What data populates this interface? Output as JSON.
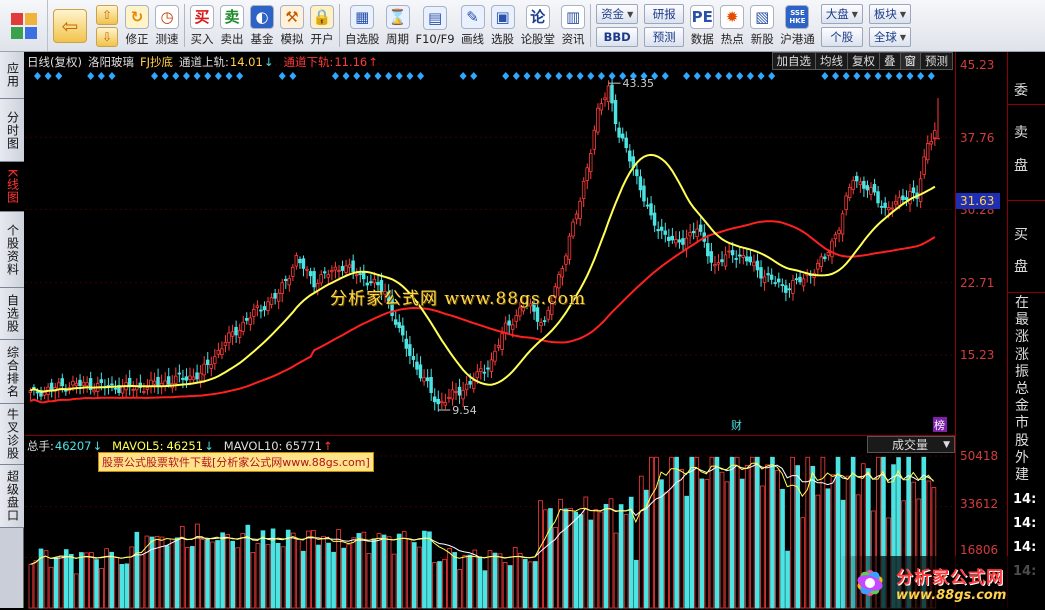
{
  "toolbar": {
    "groups": [
      {
        "label": "修正",
        "icon": "refresh-icon"
      },
      {
        "label": "测速",
        "icon": "clock-icon"
      },
      {
        "label": "买入",
        "icon": "buy-icon",
        "glyph": "买"
      },
      {
        "label": "卖出",
        "icon": "sell-icon",
        "glyph": "卖"
      },
      {
        "label": "基金",
        "icon": "fund-icon"
      },
      {
        "label": "模拟",
        "icon": "hammer-icon"
      },
      {
        "label": "开户",
        "icon": "lock-icon"
      },
      {
        "label": "自选股",
        "icon": "watchlist-icon"
      },
      {
        "label": "周期",
        "icon": "period-icon"
      },
      {
        "label": "F10/F9",
        "icon": "f10-icon"
      },
      {
        "label": "画线",
        "icon": "draw-line-icon"
      },
      {
        "label": "选股",
        "icon": "stock-picker-icon"
      },
      {
        "label": "论股堂",
        "icon": "discussion-icon",
        "glyph": "论"
      },
      {
        "label": "资讯",
        "icon": "news-icon"
      },
      {
        "label": "数据",
        "icon": "pe-data-icon",
        "glyph": "PE"
      },
      {
        "label": "热点",
        "icon": "hot-icon"
      },
      {
        "label": "新股",
        "icon": "new-stock-icon"
      },
      {
        "label": "沪港通",
        "icon": "hk-connect-icon",
        "glyph": "SSE HKE"
      }
    ],
    "pills": {
      "zijin": "资金",
      "bbd": "BBD",
      "yanbao": "研报",
      "yuce": "预测",
      "dapan": "大盘",
      "bankuai": "板块",
      "gegu": "个股",
      "quanqiu": "全球"
    }
  },
  "left_tabs": [
    "应用",
    "分时图",
    "K线图",
    "个股资料",
    "自选股",
    "综合排名",
    "牛叉诊股",
    "超级盘口"
  ],
  "left_tab_active": 2,
  "chart": {
    "period": "日线(复权)",
    "stock_name": "洛阳玻璃",
    "indicator": "FJ抄底",
    "upper_label": "通道上轨:",
    "upper_value": "14.01",
    "upper_arrow": "↓",
    "lower_label": "通道下轨:",
    "lower_value": "11.16",
    "lower_arrow": "↑",
    "menu": [
      "加自选",
      "均线",
      "复权",
      "叠",
      "窗",
      "预测"
    ],
    "watermark": "分析家公式网   www.88gs.com",
    "high_label": "43.35",
    "low_label": "9.54",
    "event_labels": [
      "财",
      "榜"
    ],
    "colors": {
      "up": "#ff3b3b",
      "down": "#4ce3e3",
      "ma_fast": "#ffff55",
      "ma_slow": "#ff2020",
      "signal": "#2fa8ff"
    }
  },
  "price_axis": {
    "ticks": [
      "45.23",
      "37.76",
      "30.28",
      "22.71",
      "15.23"
    ],
    "current": "31.63"
  },
  "volume": {
    "total_label": "总手:",
    "total_value": "46207",
    "total_arrow": "↓",
    "mavol5_label": "MAVOL5:",
    "mavol5_value": "46251",
    "mavol5_arrow": "↓",
    "mavol10_label": "MAVOL10:",
    "mavol10_value": "65771",
    "mavol10_arrow": "↑",
    "banner": "股票公式股票软件下载[分析家公式网www.88gs.com]",
    "type_select": "成交量",
    "axis_ticks": [
      "50418",
      "33612",
      "16806"
    ]
  },
  "right_panel": {
    "wei": "委",
    "mai_pan": [
      "卖",
      "盘"
    ],
    "mai_pan2": [
      "买",
      "盘"
    ],
    "list": [
      "在",
      "最",
      "涨",
      "涨",
      "振",
      "总",
      "金",
      "市",
      "股",
      "外",
      "建"
    ],
    "times": [
      "14:",
      "14:",
      "14:",
      "14:"
    ]
  },
  "logo": {
    "title": "分析家公式网",
    "url": "www.88gs.com"
  }
}
